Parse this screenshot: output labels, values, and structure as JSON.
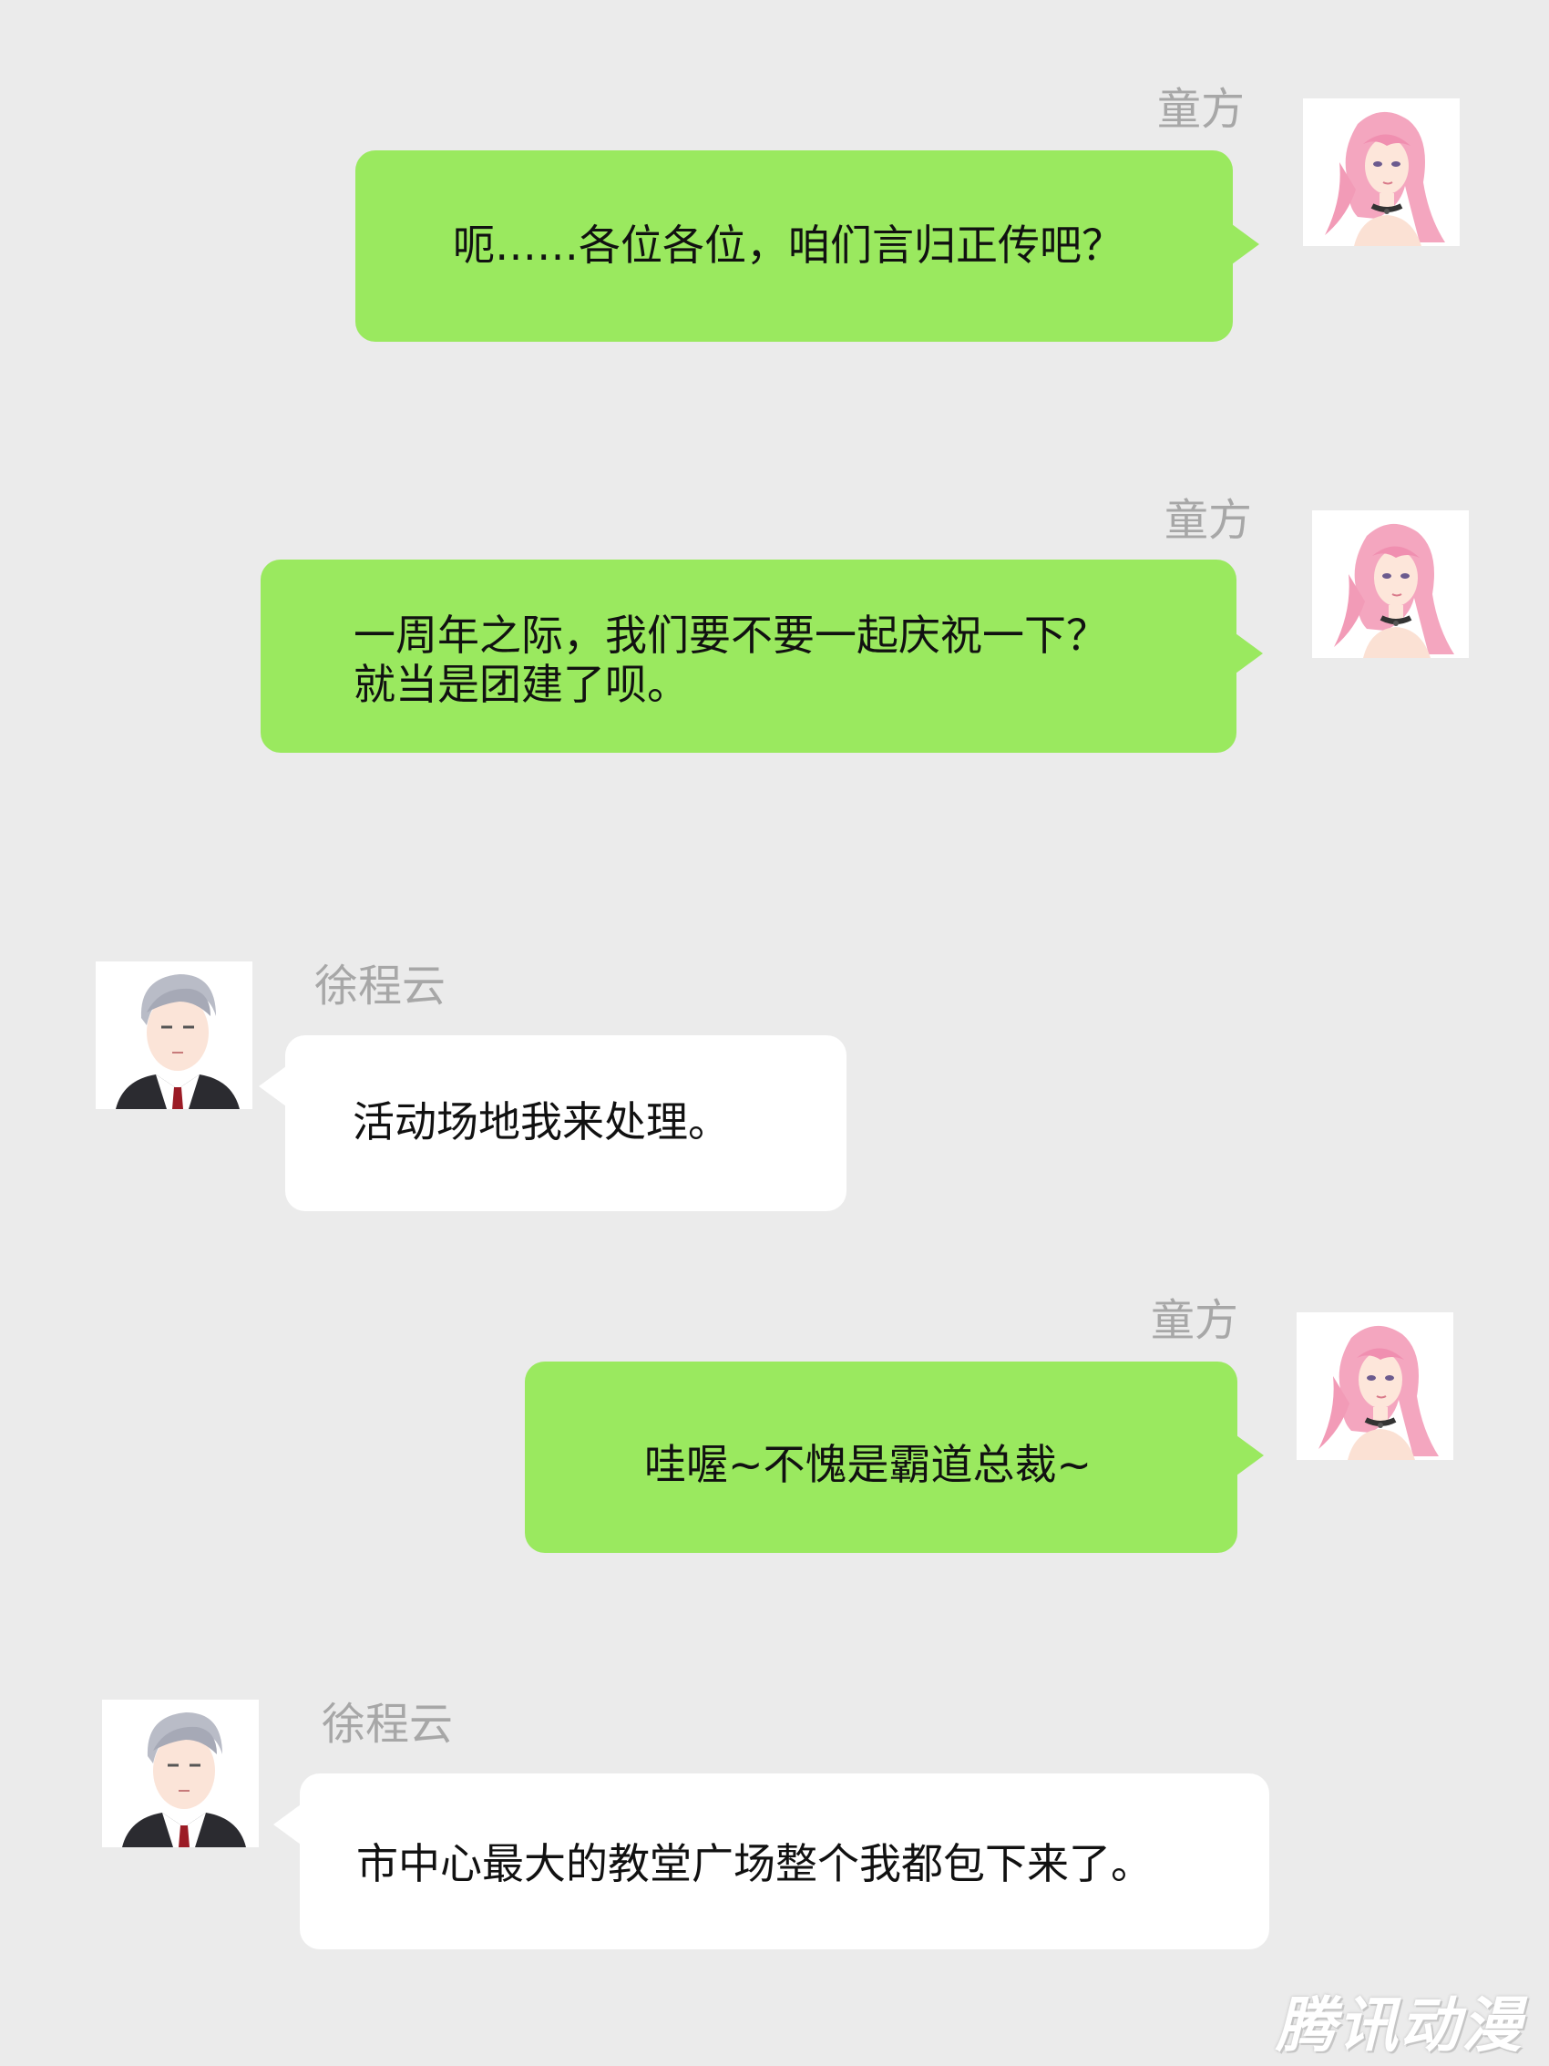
{
  "colors": {
    "background": "#ebebeb",
    "self_bubble": "#9ae95f",
    "other_bubble": "#ffffff",
    "sender_name": "#a7a7a7"
  },
  "messages": [
    {
      "sender": "童方",
      "side": "right",
      "avatar": "pink-hair-girl-avatar",
      "text": "呃……各位各位，咱们言归正传吧？"
    },
    {
      "sender": "童方",
      "side": "right",
      "avatar": "pink-hair-girl-avatar",
      "text": "一周年之际，我们要不要一起庆祝一下？\n就当是团建了呗。"
    },
    {
      "sender": "徐程云",
      "side": "left",
      "avatar": "silver-hair-man-avatar",
      "text": "活动场地我来处理。"
    },
    {
      "sender": "童方",
      "side": "right",
      "avatar": "pink-hair-girl-avatar",
      "text": "哇喔~不愧是霸道总裁~"
    },
    {
      "sender": "徐程云",
      "side": "left",
      "avatar": "silver-hair-man-avatar",
      "text": "市中心最大的教堂广场整个我都包下来了。"
    }
  ],
  "watermark": "腾讯动漫"
}
